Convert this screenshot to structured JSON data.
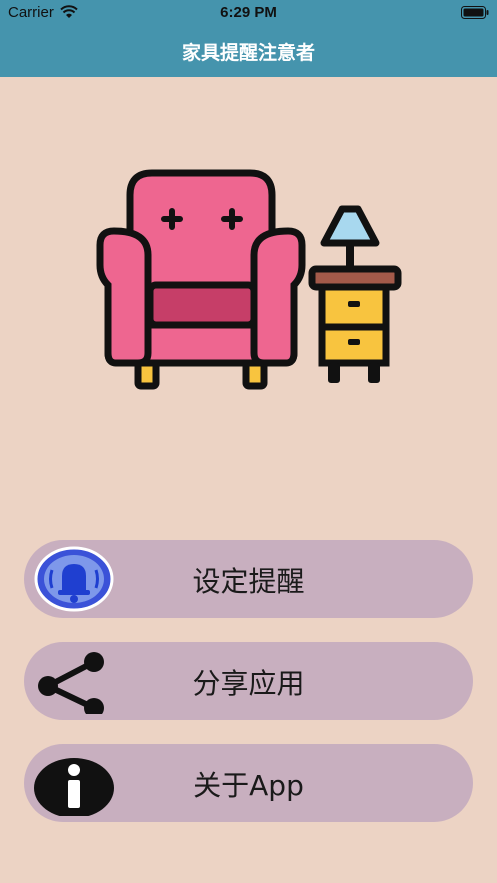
{
  "status": {
    "carrier": "Carrier",
    "time": "6:29 PM"
  },
  "nav": {
    "title": "家具提醒注意者"
  },
  "menu": {
    "set_reminder": "设定提醒",
    "share_app": "分享应用",
    "about": "关于App"
  },
  "colors": {
    "bar": "#4594ad",
    "background": "#ecd3c4",
    "button": "#c8afbf",
    "sofa": "#ee6690",
    "drawer": "#f8c43f"
  },
  "icons": [
    "wifi-icon",
    "battery-icon",
    "bell-icon",
    "share-icon",
    "info-icon"
  ]
}
